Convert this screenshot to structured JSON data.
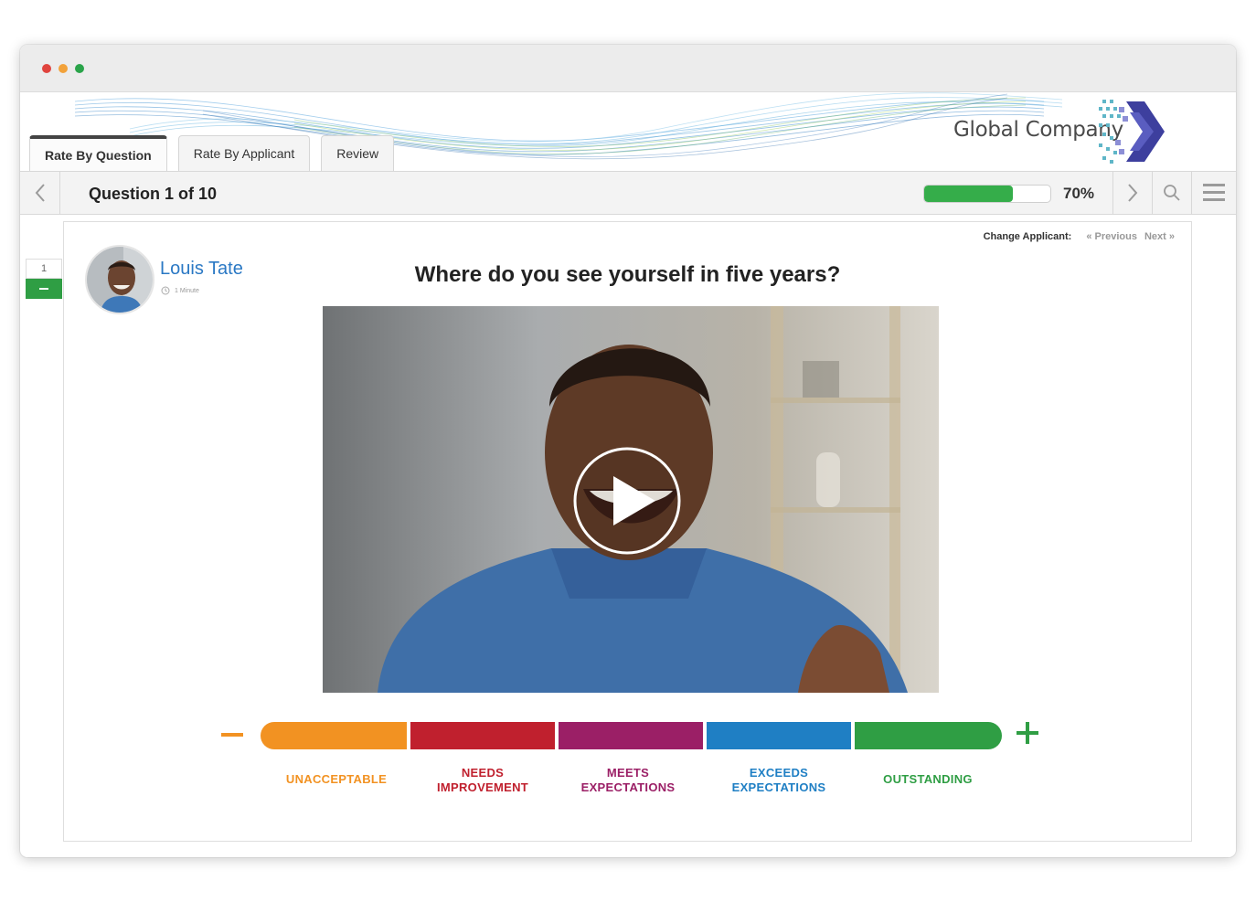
{
  "brand": {
    "name": "Global Company",
    "colors": {
      "accent_blue": "#2a78c4",
      "logo_purple": "#3d3f9e",
      "logo_teal": "#5fb6c8"
    }
  },
  "window": {
    "controls": [
      "close",
      "minimize",
      "maximize"
    ]
  },
  "tabs": [
    {
      "label": "Rate By Question",
      "active": true
    },
    {
      "label": "Rate By Applicant",
      "active": false
    },
    {
      "label": "Review",
      "active": false
    }
  ],
  "toolbar": {
    "title": "Question 1 of 10",
    "progress_value": 0.7,
    "progress_label": "70%",
    "progress_color": "#35ad4a",
    "icons": [
      "chevron-left-icon",
      "chevron-right-icon",
      "search-icon",
      "hamburger-menu-icon"
    ]
  },
  "sidebar": {
    "question_number": "1",
    "toggle_icon": "minus-icon",
    "toggle_color": "#2f9e44"
  },
  "applicant": {
    "change_label": "Change Applicant:",
    "previous_label": "« Previous",
    "next_label": "Next »",
    "name": "Louis Tate",
    "duration": "1 Minute"
  },
  "question": {
    "text": "Where do you see yourself in five years?"
  },
  "video": {
    "play_icon": "play-icon"
  },
  "rating": {
    "minus_color": "#f29222",
    "plus_color": "#2f9e44",
    "options": [
      {
        "label": "UNACCEPTABLE",
        "color": "#f29222"
      },
      {
        "label": "NEEDS\nIMPROVEMENT",
        "color": "#c0202e"
      },
      {
        "label": "MEETS\nEXPECTATIONS",
        "color": "#9b1f66"
      },
      {
        "label": "EXCEEDS\nEXPECTATIONS",
        "color": "#1f7fc4"
      },
      {
        "label": "OUTSTANDING",
        "color": "#2f9e44"
      }
    ]
  }
}
